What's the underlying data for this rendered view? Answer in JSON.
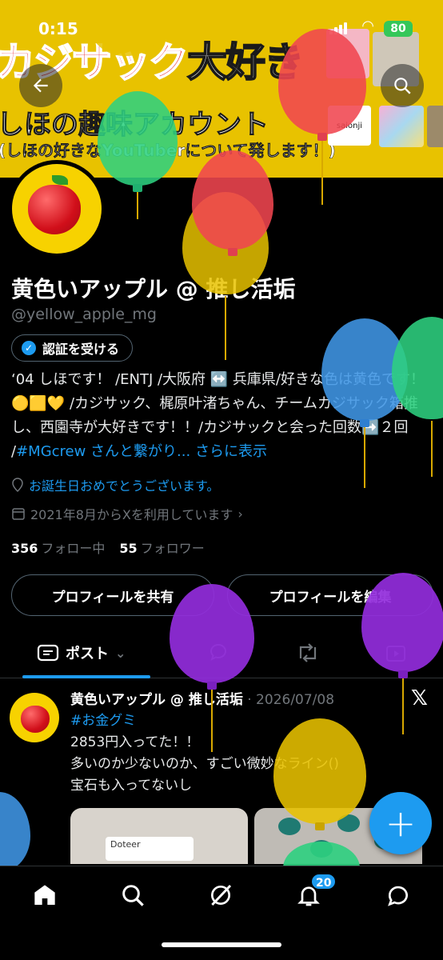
{
  "status_bar": {
    "time": "0:15",
    "battery": "80"
  },
  "banner": {
    "title_red": "カジサック",
    "title_white": "大好き",
    "subtitle_main": "しほの趣味アカウント",
    "subtitle_small": "(しほの好きなYouTuberについて発します！)",
    "photo_label": "saionji"
  },
  "profile": {
    "name": "黄色いアップル @ 推し活垢",
    "handle": "@yellow_apple_mg",
    "verify_label": "認証を受ける",
    "bio_text": "‘04 しほです！ /ENTJ /大阪府 ↔️ 兵庫県/好きな色は黄色です！🟡🟨💛 /カジサック、梶原叶渚ちゃん、チームカジサック箱推し、西園寺が大好きです！！/カジサックと会った回数➡️２回 /",
    "bio_link": "#MGcrew さんと繋がり...",
    "bio_more": "さらに表示",
    "birthday_text": "お誕生日おめでとうございます。",
    "joined_text": "2021年8月からXを利用しています",
    "following_count": "356",
    "following_label": "フォロー中",
    "followers_count": "55",
    "followers_label": "フォロワー",
    "share_button": "プロフィールを共有",
    "edit_button": "プロフィールを編集"
  },
  "tabs": {
    "posts_label": "ポスト"
  },
  "post": {
    "author": "黄色いアップル @ 推し活垢",
    "date": "· 2026/07/08",
    "hashtag": "#お金グミ",
    "line1": "2853円入ってた！！",
    "line2": "多いのか少ないのか、すごい微妙なライン()",
    "line3": "宝石も入ってないし",
    "media1_label": "Doteer"
  },
  "x_logo": "𝕏",
  "fab_label": "+",
  "bottom_nav": {
    "notifications_badge": "20"
  },
  "colors": {
    "accent": "#1d9bf0",
    "banner": "#e8c200",
    "background": "#000000"
  }
}
